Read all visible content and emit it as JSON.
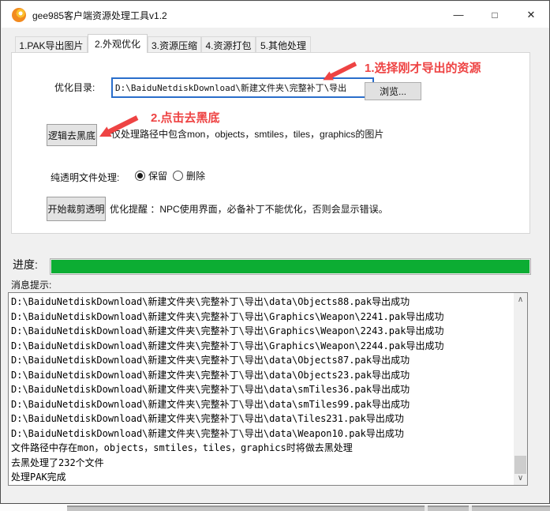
{
  "titlebar": {
    "title": "gee985客户端资源处理工具v1.2",
    "minimize_glyph": "—",
    "maximize_glyph": "□",
    "close_glyph": "✕"
  },
  "icons": {
    "app_icon": "orange-swirl-circle",
    "minimize_icon": "—",
    "maximize_icon": "□",
    "close_icon": "✕",
    "scroll_up_icon": "∧",
    "scroll_down_icon": "∨"
  },
  "tabs": [
    {
      "label": "1.PAK导出图片"
    },
    {
      "label": "2.外观优化"
    },
    {
      "label": "3.资源压缩"
    },
    {
      "label": "4.资源打包"
    },
    {
      "label": "5.其他处理"
    }
  ],
  "optimize": {
    "dir_label": "优化目录:",
    "dir_value": "D:\\BaiduNetdiskDownload\\新建文件夹\\完整补丁\\导出",
    "browse_button": "浏览...",
    "annotation1": "1.选择刚才导出的资源",
    "annotation2": "2.点击去黑底",
    "remove_black_button": "逻辑去黑底",
    "filter_hint": "仅处理路径中包含mon，objects，smtiles，tiles，graphics的图片",
    "transparent_label": "纯透明文件处理:",
    "radio_keep": "保留",
    "radio_delete": "删除",
    "radio_selected": "保留",
    "crop_button": "开始裁剪透明",
    "crop_hint": "优化提醒 ：NPC使用界面，必备补丁不能优化，否则会显示错误。"
  },
  "progress": {
    "label": "进度:",
    "percent": 100,
    "bar_color": "#0cad33"
  },
  "messages": {
    "label": "消息提示:",
    "lines": [
      "D:\\BaiduNetdiskDownload\\新建文件夹\\完整补丁\\导出\\data\\Objects88.pak导出成功",
      "D:\\BaiduNetdiskDownload\\新建文件夹\\完整补丁\\导出\\Graphics\\Weapon\\2241.pak导出成功",
      "D:\\BaiduNetdiskDownload\\新建文件夹\\完整补丁\\导出\\Graphics\\Weapon\\2243.pak导出成功",
      "D:\\BaiduNetdiskDownload\\新建文件夹\\完整补丁\\导出\\Graphics\\Weapon\\2244.pak导出成功",
      "D:\\BaiduNetdiskDownload\\新建文件夹\\完整补丁\\导出\\data\\Objects87.pak导出成功",
      "D:\\BaiduNetdiskDownload\\新建文件夹\\完整补丁\\导出\\data\\Objects23.pak导出成功",
      "D:\\BaiduNetdiskDownload\\新建文件夹\\完整补丁\\导出\\data\\smTiles36.pak导出成功",
      "D:\\BaiduNetdiskDownload\\新建文件夹\\完整补丁\\导出\\data\\smTiles99.pak导出成功",
      "D:\\BaiduNetdiskDownload\\新建文件夹\\完整补丁\\导出\\data\\Tiles231.pak导出成功",
      "D:\\BaiduNetdiskDownload\\新建文件夹\\完整补丁\\导出\\data\\Weapon10.pak导出成功",
      "文件路径中存在mon，objects，smtiles，tiles，graphics时将做去黑处理",
      "去黑处理了232个文件",
      "处理PAK完成"
    ]
  },
  "colors": {
    "annotation_red": "#ee4343",
    "progress_green": "#0cad33",
    "input_focus_blue": "#2a6ecb",
    "titlebar_bg": "#ffffff",
    "client_bg": "#f0f0f0"
  }
}
